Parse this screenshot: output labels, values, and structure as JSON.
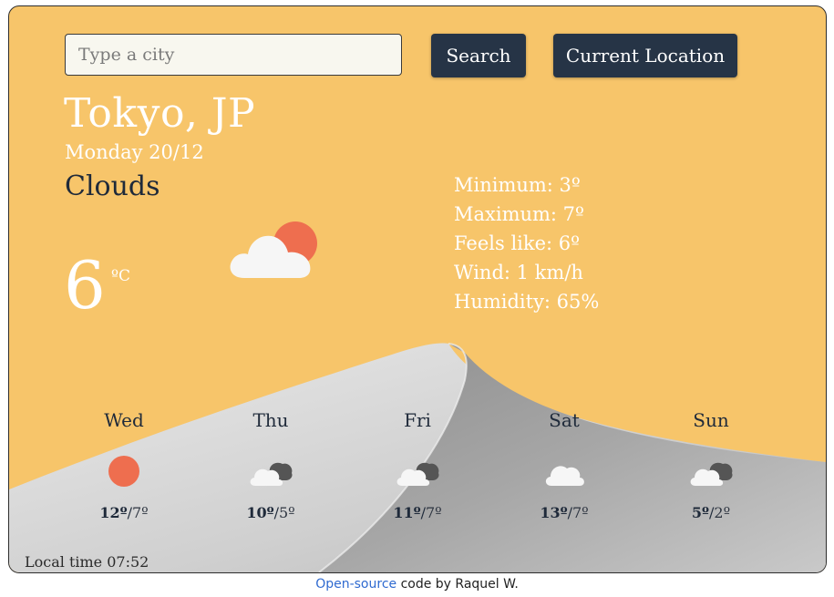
{
  "search": {
    "placeholder": "Type a city",
    "value": ""
  },
  "buttons": {
    "search_label": "Search",
    "location_label": "Current Location"
  },
  "current": {
    "city": "Tokyo, JP",
    "date": "Monday 20/12",
    "condition": "Clouds",
    "temperature": "6",
    "unit": "ºC",
    "icon": "sun-behind-cloud-icon"
  },
  "details": {
    "minimum": "Minimum: 3º",
    "maximum": "Maximum: 7º",
    "feels_like": "Feels like: 6º",
    "wind": "Wind: 1 km/h",
    "humidity": "Humidity: 65%"
  },
  "forecast": [
    {
      "day": "Wed",
      "max": "12º",
      "min": "7º",
      "icon": "sun-icon"
    },
    {
      "day": "Thu",
      "max": "10º",
      "min": "5º",
      "icon": "broken-clouds-icon"
    },
    {
      "day": "Fri",
      "max": "11º",
      "min": "7º",
      "icon": "broken-clouds-icon"
    },
    {
      "day": "Sat",
      "max": "13º",
      "min": "7º",
      "icon": "cloud-icon"
    },
    {
      "day": "Sun",
      "max": "5º",
      "min": "2º",
      "icon": "broken-clouds-icon"
    }
  ],
  "local_time": "Local time 07:52",
  "footer": {
    "link_text": "Open-source",
    "text": " code by Raquel W."
  },
  "colors": {
    "background": "#f7c56a",
    "button": "#263446",
    "sun": "#ee6e4f",
    "link": "#2f6ad0"
  }
}
